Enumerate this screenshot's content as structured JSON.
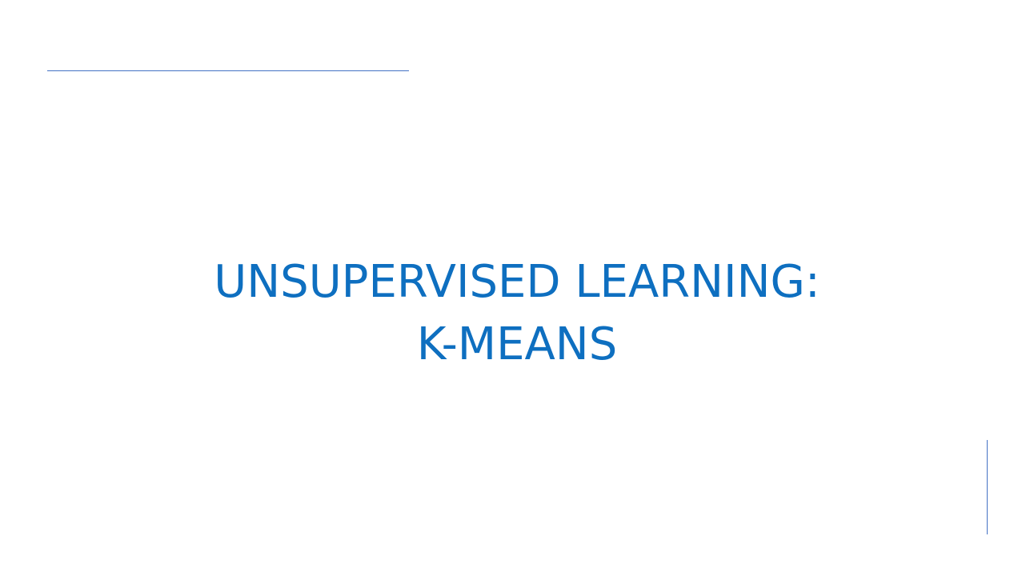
{
  "slide": {
    "title_line_1": "UNSUPERVISED LEARNING:",
    "title_line_2": "K-MEANS"
  },
  "colors": {
    "title": "#0e6fc0",
    "accent_rule": "#4472c4",
    "background": "#ffffff"
  }
}
